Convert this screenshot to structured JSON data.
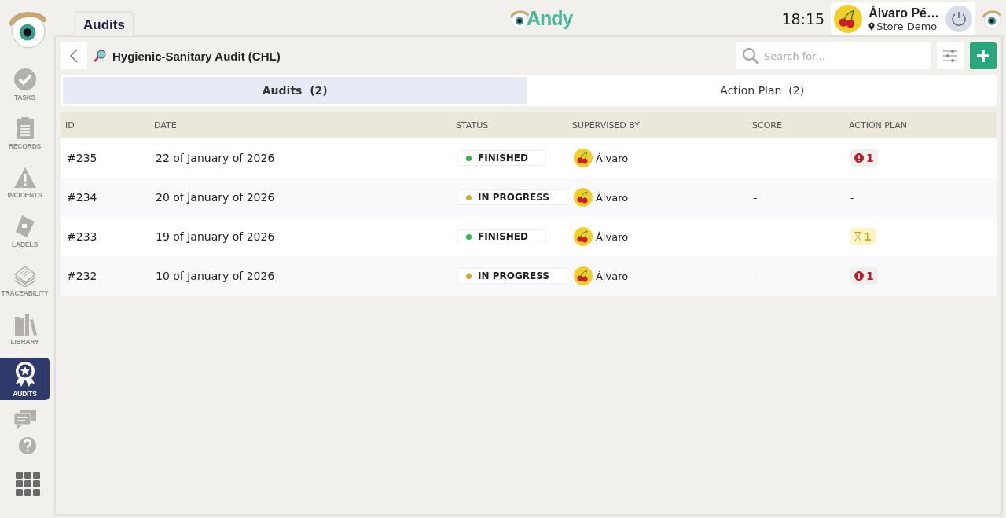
{
  "sidebar": {
    "items": [
      {
        "kind": "tasks",
        "label": "TASKS",
        "selected": false
      },
      {
        "kind": "records",
        "label": "RECORDS",
        "selected": false
      },
      {
        "kind": "incidents",
        "label": "INCIDENTS",
        "selected": false
      },
      {
        "kind": "labels",
        "label": "LABELS",
        "selected": false
      },
      {
        "kind": "traceability",
        "label": "TRACEABILITY",
        "selected": false
      },
      {
        "kind": "library",
        "label": "LIBRARY",
        "selected": false
      },
      {
        "kind": "audits",
        "label": "AUDITS",
        "selected": true
      },
      {
        "kind": "chat",
        "selected": false
      }
    ]
  },
  "header": {
    "tab": "Audits",
    "logo": "Andy",
    "time": "18:15",
    "user": {
      "name": "Álvaro Pé…",
      "store": "Store Demo"
    }
  },
  "page": {
    "title": "Hygienic-Sanitary Audit (CHL)",
    "search": {
      "placeholder": "Search for..."
    }
  },
  "tabs": [
    {
      "label": "Audits  (2)",
      "selected": true
    },
    {
      "label": "Action Plan  (2)",
      "selected": false
    }
  ],
  "table": {
    "columns": [
      "ID",
      "DATE",
      "STATUS",
      "SUPERVISED BY",
      "SCORE",
      "ACTION PLAN"
    ],
    "rows": [
      {
        "id": "#235",
        "date": "22 of January of 2026",
        "status": {
          "label": "FINISHED",
          "color": "#2db84a"
        },
        "supervisor": "Álvaro",
        "score": "",
        "action": {
          "kind": "alert",
          "count": "1"
        }
      },
      {
        "id": "#234",
        "date": "20 of January of 2026",
        "status": {
          "label": "IN PROGRESS",
          "color": "#d4aa30"
        },
        "supervisor": "Álvaro",
        "score": "-",
        "action": {
          "kind": "none",
          "count": "-"
        }
      },
      {
        "id": "#233",
        "date": "19 of January of 2026",
        "status": {
          "label": "FINISHED",
          "color": "#2db84a"
        },
        "supervisor": "Álvaro",
        "score": "",
        "action": {
          "kind": "pending",
          "count": "1"
        }
      },
      {
        "id": "#232",
        "date": "10 of January of 2026",
        "status": {
          "label": "IN PROGRESS",
          "color": "#d4aa30"
        },
        "supervisor": "Álvaro",
        "score": "-",
        "action": {
          "kind": "alert",
          "count": "1"
        }
      }
    ]
  }
}
